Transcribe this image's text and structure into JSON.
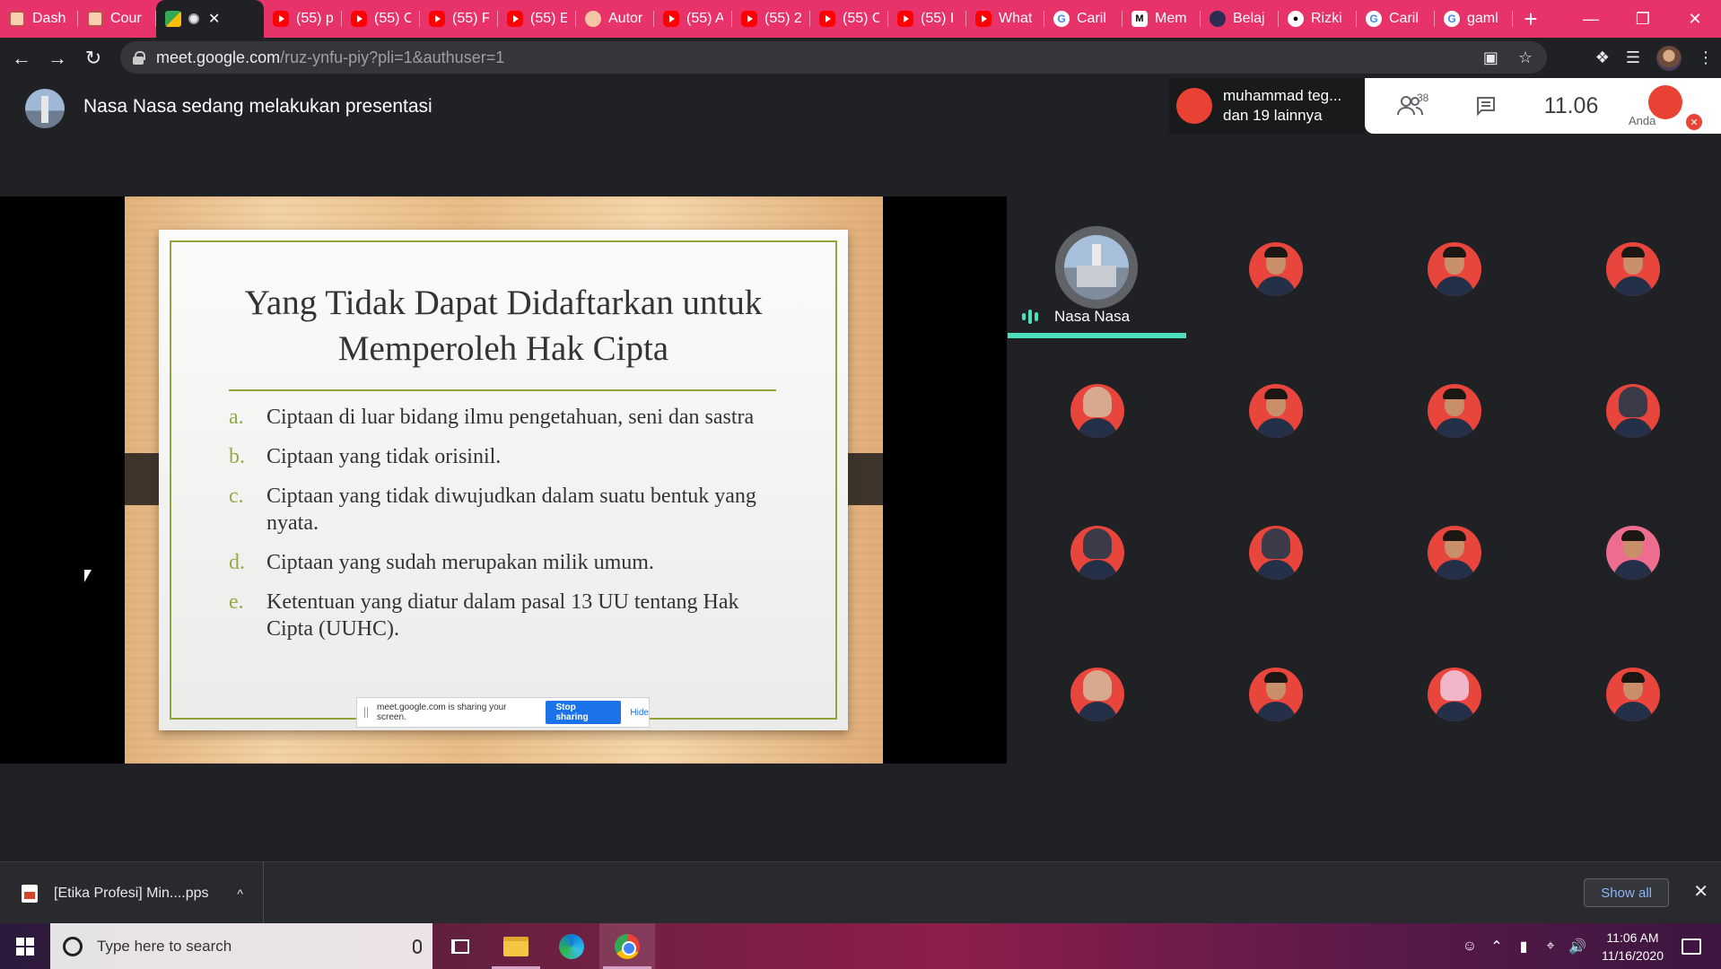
{
  "browser": {
    "tabs": [
      {
        "label": "Dash",
        "icon": "course-icon"
      },
      {
        "label": "Cour",
        "icon": "course-icon"
      },
      {
        "label": "",
        "icon": "meet-icon",
        "active": true
      },
      {
        "label": "(55) p",
        "icon": "youtube-icon"
      },
      {
        "label": "(55) C",
        "icon": "youtube-icon"
      },
      {
        "label": "(55) F",
        "icon": "youtube-icon"
      },
      {
        "label": "(55) E",
        "icon": "youtube-icon"
      },
      {
        "label": "Autor",
        "icon": "author-icon"
      },
      {
        "label": "(55) A",
        "icon": "youtube-icon"
      },
      {
        "label": "(55) 2",
        "icon": "youtube-icon"
      },
      {
        "label": "(55) C",
        "icon": "youtube-icon"
      },
      {
        "label": "(55) I",
        "icon": "youtube-icon"
      },
      {
        "label": "What",
        "icon": "youtube-icon"
      },
      {
        "label": "Caril",
        "icon": "google-icon"
      },
      {
        "label": "Mem",
        "icon": "medium-icon"
      },
      {
        "label": "Belaj",
        "icon": "belajar-icon"
      },
      {
        "label": "Rizki",
        "icon": "github-icon"
      },
      {
        "label": "Caril",
        "icon": "google-icon"
      },
      {
        "label": "gaml",
        "icon": "google-icon"
      }
    ],
    "url_host": "meet.google.com",
    "url_path": "/ruz-ynfu-piy?pli=1&authuser=1"
  },
  "meet": {
    "presenter_title": "Nasa Nasa sedang melakukan presentasi",
    "joiners_line1": "muhammad teg...",
    "joiners_line2": "dan 19 lainnya",
    "people_count": "38",
    "time": "11.06",
    "self_label": "Anda"
  },
  "slide": {
    "title_line1": "Yang Tidak Dapat Didaftarkan untuk",
    "title_line2": "Memperoleh Hak Cipta",
    "items": [
      {
        "marker": "a.",
        "text": "Ciptaan di luar bidang ilmu pengetahuan, seni dan sastra"
      },
      {
        "marker": "b.",
        "text": "Ciptaan yang tidak orisinil."
      },
      {
        "marker": "c.",
        "text": "Ciptaan yang tidak diwujudkan dalam suatu bentuk yang nyata."
      },
      {
        "marker": "d.",
        "text": "Ciptaan yang sudah merupakan milik umum."
      },
      {
        "marker": "e.",
        "text": "Ketentuan yang diatur dalam pasal 13 UU tentang Hak Cipta (UUHC)."
      }
    ],
    "share_notice": "meet.google.com is sharing your screen.",
    "stop_sharing": "Stop sharing",
    "hide": "Hide"
  },
  "grid": {
    "speaker_name": "Nasa Nasa",
    "participants": 19
  },
  "downloads": {
    "file_name": "[Etika Profesi] Min....pps",
    "show_all": "Show all"
  },
  "taskbar": {
    "search_placeholder": "Type here to search",
    "time": "11:06 AM",
    "date": "11/16/2020"
  }
}
